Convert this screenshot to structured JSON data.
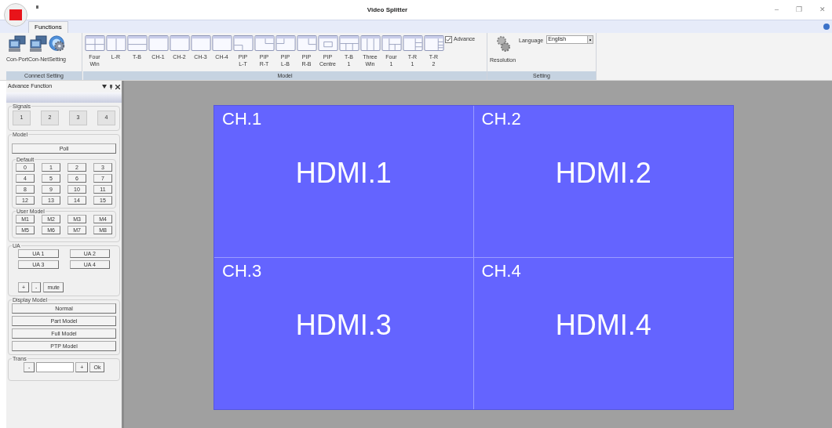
{
  "window": {
    "title": "Video Splitter",
    "controls": [
      "–",
      "❐",
      "✕"
    ]
  },
  "tabs": [
    {
      "label": "Functions",
      "selected": true
    }
  ],
  "ribbon": {
    "connect": {
      "label": "Connect Setting",
      "buttons": [
        {
          "label": "Con-Port",
          "kind": "computer"
        },
        {
          "label": "Con-Net",
          "kind": "computer"
        },
        {
          "label": "Setting",
          "kind": "gear"
        }
      ]
    },
    "model": {
      "label": "Model",
      "items": [
        {
          "lines": [
            "Four",
            "Win"
          ],
          "kind": "four"
        },
        {
          "lines": [
            "L-R"
          ],
          "kind": "lr"
        },
        {
          "lines": [
            "T-B"
          ],
          "kind": "tb"
        },
        {
          "lines": [
            "CH-1"
          ],
          "kind": "single"
        },
        {
          "lines": [
            "CH-2"
          ],
          "kind": "single"
        },
        {
          "lines": [
            "CH-3"
          ],
          "kind": "single"
        },
        {
          "lines": [
            "CH-4"
          ],
          "kind": "single"
        },
        {
          "lines": [
            "PIP",
            "L-T"
          ],
          "kind": "piplt"
        },
        {
          "lines": [
            "PIP",
            "R-T"
          ],
          "kind": "piprt"
        },
        {
          "lines": [
            "PIP",
            "L-B"
          ],
          "kind": "piplb"
        },
        {
          "lines": [
            "PIP",
            "R-B"
          ],
          "kind": "piprb"
        },
        {
          "lines": [
            "PIP",
            "Centre"
          ],
          "kind": "pipc"
        },
        {
          "lines": [
            "T-B",
            "1"
          ],
          "kind": "tb1"
        },
        {
          "lines": [
            "Three",
            "Win"
          ],
          "kind": "three"
        },
        {
          "lines": [
            "Four",
            "1"
          ],
          "kind": "four1"
        },
        {
          "lines": [
            "T-R",
            "1"
          ],
          "kind": "tr1"
        },
        {
          "lines": [
            "T-R",
            "2"
          ],
          "kind": "tr2"
        }
      ],
      "advance": {
        "label": "Advance",
        "checked": true
      }
    },
    "setting": {
      "label": "Setting",
      "resolution": "Resolution",
      "language_label": "Language",
      "language": "English"
    }
  },
  "panel": {
    "title": "Advance Function",
    "signals": {
      "label": "Signals",
      "buttons": [
        "1",
        "2",
        "3",
        "4"
      ]
    },
    "model": {
      "label": "Model",
      "poll": "Poll",
      "default": {
        "label": "Default",
        "buttons": [
          "0",
          "1",
          "2",
          "3",
          "4",
          "5",
          "6",
          "7",
          "8",
          "9",
          "10",
          "11",
          "12",
          "13",
          "14",
          "15"
        ]
      },
      "user_model": {
        "label": "User Model",
        "buttons": [
          "M1",
          "M2",
          "M3",
          "M4",
          "M5",
          "M6",
          "M7",
          "M8"
        ]
      }
    },
    "ua": {
      "label": "UA",
      "buttons": [
        "UA 1",
        "UA 2",
        "UA 3",
        "UA 4"
      ],
      "volume": [
        "+",
        "-",
        "mute"
      ]
    },
    "display_model": {
      "label": "Display Model",
      "buttons": [
        "Normal",
        "Part Model",
        "Full Model",
        "PTP Model"
      ]
    },
    "trans": {
      "label": "Trans",
      "minus": "-",
      "plus": "+",
      "ok": "Ok"
    }
  },
  "display": {
    "tiles": [
      {
        "channel": "CH.1",
        "source": "HDMI.1"
      },
      {
        "channel": "CH.2",
        "source": "HDMI.2"
      },
      {
        "channel": "CH.3",
        "source": "HDMI.3"
      },
      {
        "channel": "CH.4",
        "source": "HDMI.4"
      }
    ]
  }
}
